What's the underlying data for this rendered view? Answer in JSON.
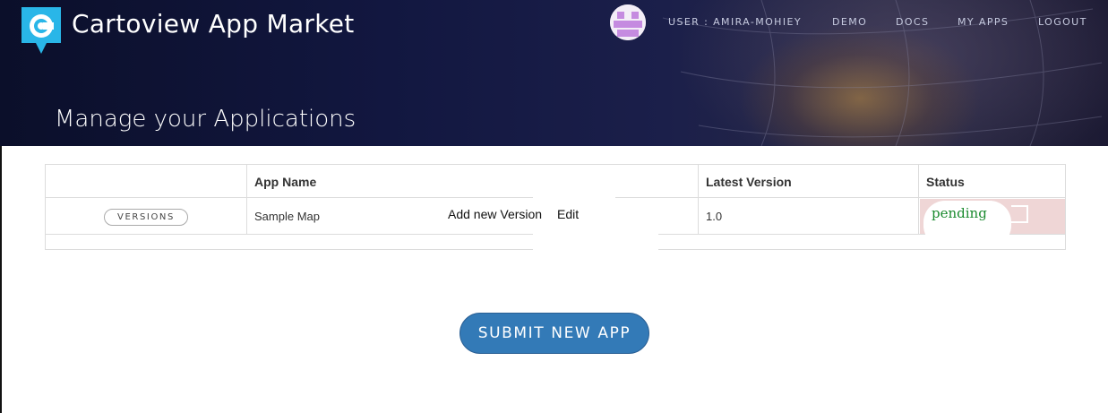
{
  "header": {
    "app_title": "Cartoview App Market",
    "nav": [
      {
        "label": "USER : AMIRA-MOHIEY"
      },
      {
        "label": "DEMO"
      },
      {
        "label": "DOCS"
      },
      {
        "label": "MY APPS"
      },
      {
        "label": "LOGOUT"
      }
    ],
    "page_title": "Manage your Applications"
  },
  "table": {
    "columns": [
      "",
      "App Name",
      "Latest Version",
      "Status"
    ],
    "rows": [
      {
        "versions_label": "VERSIONS",
        "app_name": "Sample Map",
        "add_version_label": "Add new Version",
        "edit_label": "Edit",
        "latest_version": "1.0",
        "status": "pending"
      }
    ]
  },
  "actions": {
    "submit_label": "SUBMIT NEW APP"
  },
  "colors": {
    "brand": "#29b6e8",
    "primary_button": "#337ab7",
    "status_pending": "#1a8a2e",
    "status_cell_bg": "#efd6d6"
  },
  "icons": {
    "logo": "cartoview-logo-icon",
    "avatar": "user-avatar-identicon"
  }
}
